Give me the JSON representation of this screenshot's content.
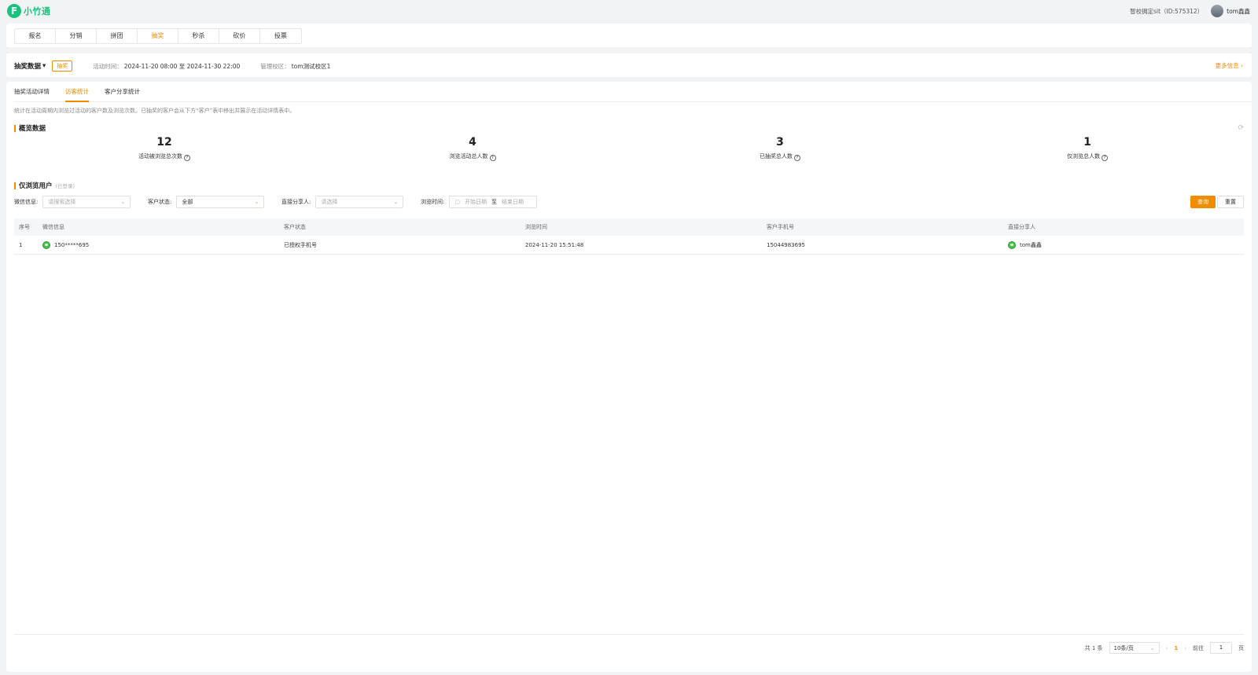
{
  "brand": {
    "logo_mark": "F",
    "name": "小竹通"
  },
  "header": {
    "school": "智校拥定sit（ID:575312）",
    "username": "tom鑫鑫"
  },
  "nav": {
    "items": [
      {
        "label": "报名"
      },
      {
        "label": "分销"
      },
      {
        "label": "拼团"
      },
      {
        "label": "抽奖",
        "active": true
      },
      {
        "label": "秒杀"
      },
      {
        "label": "砍价"
      },
      {
        "label": "投票"
      }
    ]
  },
  "activity": {
    "title": "抽奖数据",
    "tag": "抽奖",
    "time_label": "活动时间：",
    "time_value": "2024-11-20 08:00 至 2024-11-30 22:00",
    "campus_label": "管理校区：",
    "campus_value": "tom测试校区1",
    "more_label": "更多信息"
  },
  "subtabs": [
    {
      "label": "抽奖活动详情"
    },
    {
      "label": "访客统计",
      "active": true
    },
    {
      "label": "客户分享统计"
    }
  ],
  "description": "统计在活动周期内浏览过活动的客户数及浏览次数。已抽奖的客户会从下方“客户”表中移出并展示在活动详情表中。",
  "overview": {
    "title": "概览数据",
    "stats": [
      {
        "value": "12",
        "label": "活动被浏览总次数"
      },
      {
        "value": "4",
        "label": "浏览活动总人数"
      },
      {
        "value": "3",
        "label": "已抽奖总人数"
      },
      {
        "value": "1",
        "label": "仅浏览总人数"
      }
    ]
  },
  "browse_only": {
    "title": "仅浏览用户",
    "note": "(已登录)",
    "filters": {
      "wechat_label": "微信信息:",
      "wechat_placeholder": "请搜索选择",
      "status_label": "客户状态:",
      "status_value": "全部",
      "sharer_label": "直接分享人:",
      "sharer_placeholder": "请选择",
      "time_label": "浏览时间:",
      "start_placeholder": "开始日期",
      "range_sep": "至",
      "end_placeholder": "结束日期",
      "query_button": "查询",
      "reset_button": "重置"
    },
    "table": {
      "columns": [
        "序号",
        "微信信息",
        "客户状态",
        "浏览时间",
        "客户手机号",
        "直接分享人"
      ],
      "rows": [
        {
          "index": "1",
          "wechat": "150*****695",
          "status": "已授权手机号",
          "time": "2024-11-20 15:51:48",
          "phone": "15044983695",
          "sharer": "tom鑫鑫"
        }
      ]
    }
  },
  "pagination": {
    "total": "共 1 条",
    "page_size": "10条/页",
    "current_page": "1",
    "goto_label": "前往",
    "goto_value": "1",
    "page_unit": "页"
  },
  "colors": {
    "accent": "#f08c00",
    "brand": "#19c37d"
  },
  "icons": [
    "refresh-icon",
    "help-circle-icon",
    "calendar-icon",
    "chevron-down-icon",
    "chevron-right-icon",
    "chevron-left-icon"
  ]
}
